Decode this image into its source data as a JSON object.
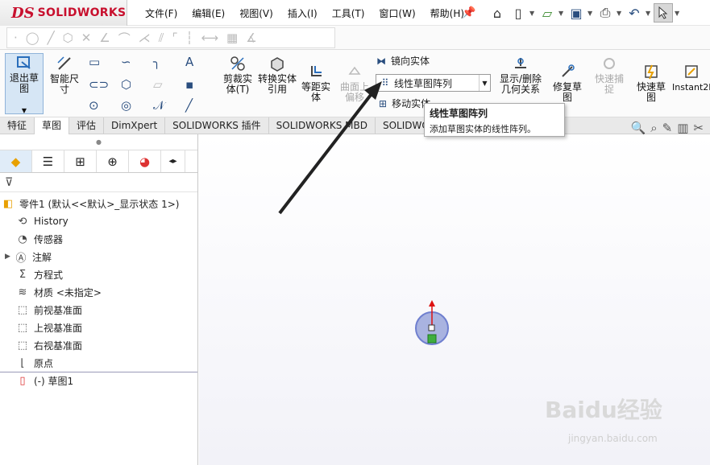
{
  "app": {
    "brand": "SOLIDWORKS",
    "logo_mark": "DS"
  },
  "menu": [
    {
      "label": "文件(F)"
    },
    {
      "label": "编辑(E)"
    },
    {
      "label": "视图(V)"
    },
    {
      "label": "插入(I)"
    },
    {
      "label": "工具(T)"
    },
    {
      "label": "窗口(W)"
    },
    {
      "label": "帮助(H)"
    }
  ],
  "quick_icons": [
    "home-icon",
    "new-doc-icon",
    "open-icon",
    "save-icon",
    "print-icon",
    "undo-icon",
    "select-pointer-icon"
  ],
  "ribbon": {
    "exit_sketch": "退出草图",
    "smart_dimension": "智能尺寸",
    "trim": "剪裁实体(T)",
    "convert": "转换实体引用",
    "offset": "等距实体",
    "surface_offset": "曲面上偏移",
    "mirror": "镜向实体",
    "linear_pattern": "线性草图阵列",
    "move": "移动实体",
    "show_relations": "显示/删除几何关系",
    "repair": "修复草图",
    "quick_snap": "快速捕捉",
    "rapid_sketch": "快速草图",
    "instant2d": "Instant2D"
  },
  "tabs": [
    {
      "label": "特征"
    },
    {
      "label": "草图"
    },
    {
      "label": "评估"
    },
    {
      "label": "DimXpert"
    },
    {
      "label": "SOLIDWORKS 插件"
    },
    {
      "label": "SOLIDWORKS MBD"
    },
    {
      "label": "SOLIDWO"
    }
  ],
  "tooltip": {
    "title": "线性草图阵列",
    "description": "添加草图实体的线性阵列。"
  },
  "tree": [
    {
      "label": "零件1 (默认<<默认>_显示状态 1>)",
      "icon": "part-icon"
    },
    {
      "label": "History",
      "icon": "history-icon"
    },
    {
      "label": "传感器",
      "icon": "sensor-icon"
    },
    {
      "label": "注解",
      "icon": "annotation-icon"
    },
    {
      "label": "方程式",
      "icon": "equation-icon"
    },
    {
      "label": "材质 <未指定>",
      "icon": "material-icon"
    },
    {
      "label": "前视基准面",
      "icon": "plane-icon"
    },
    {
      "label": "上视基准面",
      "icon": "plane-icon"
    },
    {
      "label": "右视基准面",
      "icon": "plane-icon"
    },
    {
      "label": "原点",
      "icon": "origin-icon"
    },
    {
      "label": "(-) 草图1",
      "icon": "sketch-icon"
    }
  ],
  "watermark": {
    "text": "Baidu经验",
    "url": "jingyan.baidu.com"
  },
  "colors": {
    "accent": "#2a6ebb",
    "brand": "#c8102e",
    "active_tab": "#ffffff"
  }
}
